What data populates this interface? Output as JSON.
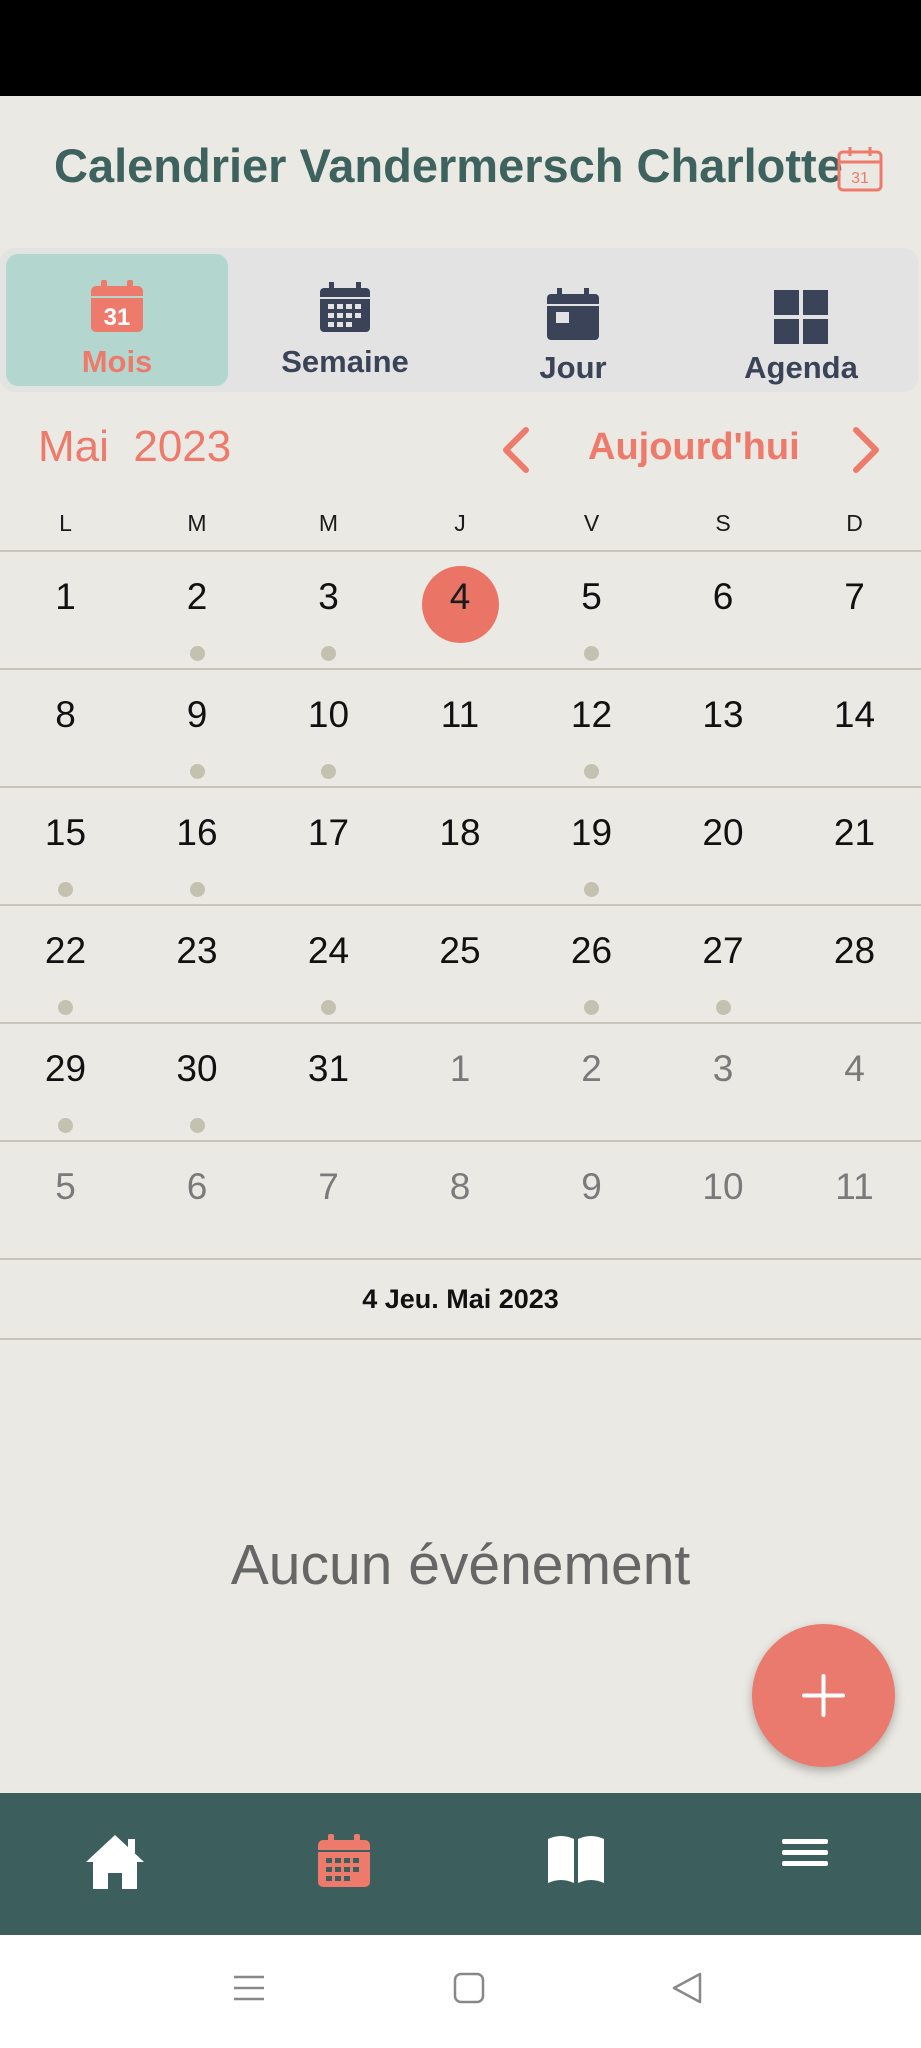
{
  "header": {
    "title": "Calendrier Vandermersch Charlotte",
    "calendar_icon": "calendar-icon"
  },
  "view_tabs": [
    {
      "label": "Mois",
      "icon": "calendar-month-icon",
      "active": true,
      "badge": "31"
    },
    {
      "label": "Semaine",
      "icon": "calendar-week-icon",
      "active": false
    },
    {
      "label": "Jour",
      "icon": "calendar-day-icon",
      "active": false
    },
    {
      "label": "Agenda",
      "icon": "grid-icon",
      "active": false
    }
  ],
  "month_nav": {
    "month": "Mai",
    "year": "2023",
    "today_label": "Aujourd'hui",
    "prev_icon": "chevron-left-icon",
    "next_icon": "chevron-right-icon"
  },
  "weekdays": [
    "L",
    "M",
    "M",
    "J",
    "V",
    "S",
    "D"
  ],
  "weeks": [
    [
      {
        "d": "1",
        "cur": true,
        "dot": false
      },
      {
        "d": "2",
        "cur": true,
        "dot": true
      },
      {
        "d": "3",
        "cur": true,
        "dot": true
      },
      {
        "d": "4",
        "cur": true,
        "dot": false,
        "today": true
      },
      {
        "d": "5",
        "cur": true,
        "dot": true
      },
      {
        "d": "6",
        "cur": true,
        "dot": false
      },
      {
        "d": "7",
        "cur": true,
        "dot": false
      }
    ],
    [
      {
        "d": "8",
        "cur": true,
        "dot": false
      },
      {
        "d": "9",
        "cur": true,
        "dot": true
      },
      {
        "d": "10",
        "cur": true,
        "dot": true
      },
      {
        "d": "11",
        "cur": true,
        "dot": false
      },
      {
        "d": "12",
        "cur": true,
        "dot": true
      },
      {
        "d": "13",
        "cur": true,
        "dot": false
      },
      {
        "d": "14",
        "cur": true,
        "dot": false
      }
    ],
    [
      {
        "d": "15",
        "cur": true,
        "dot": true
      },
      {
        "d": "16",
        "cur": true,
        "dot": true
      },
      {
        "d": "17",
        "cur": true,
        "dot": false
      },
      {
        "d": "18",
        "cur": true,
        "dot": false
      },
      {
        "d": "19",
        "cur": true,
        "dot": true
      },
      {
        "d": "20",
        "cur": true,
        "dot": false
      },
      {
        "d": "21",
        "cur": true,
        "dot": false
      }
    ],
    [
      {
        "d": "22",
        "cur": true,
        "dot": true
      },
      {
        "d": "23",
        "cur": true,
        "dot": false
      },
      {
        "d": "24",
        "cur": true,
        "dot": true
      },
      {
        "d": "25",
        "cur": true,
        "dot": false
      },
      {
        "d": "26",
        "cur": true,
        "dot": true
      },
      {
        "d": "27",
        "cur": true,
        "dot": true
      },
      {
        "d": "28",
        "cur": true,
        "dot": false
      }
    ],
    [
      {
        "d": "29",
        "cur": true,
        "dot": true
      },
      {
        "d": "30",
        "cur": true,
        "dot": true
      },
      {
        "d": "31",
        "cur": true,
        "dot": false
      },
      {
        "d": "1",
        "cur": false,
        "dot": false
      },
      {
        "d": "2",
        "cur": false,
        "dot": false
      },
      {
        "d": "3",
        "cur": false,
        "dot": false
      },
      {
        "d": "4",
        "cur": false,
        "dot": false
      }
    ],
    [
      {
        "d": "5",
        "cur": false,
        "dot": false
      },
      {
        "d": "6",
        "cur": false,
        "dot": false
      },
      {
        "d": "7",
        "cur": false,
        "dot": false
      },
      {
        "d": "8",
        "cur": false,
        "dot": false
      },
      {
        "d": "9",
        "cur": false,
        "dot": false
      },
      {
        "d": "10",
        "cur": false,
        "dot": false
      },
      {
        "d": "11",
        "cur": false,
        "dot": false
      }
    ]
  ],
  "selected_date": "4 Jeu. Mai 2023",
  "empty_state": "Aucun événement",
  "fab_icon": "plus-icon",
  "bottom_nav": [
    {
      "name": "home-icon"
    },
    {
      "name": "calendar-icon",
      "active": true
    },
    {
      "name": "book-icon"
    },
    {
      "name": "menu-icon"
    }
  ],
  "system_nav": [
    "recent-apps-icon",
    "home-square-icon",
    "back-icon"
  ],
  "colors": {
    "accent": "#ee7a6c",
    "teal": "#3c5e5d",
    "active_tab": "#b3d7cf",
    "background": "#ebe9e3",
    "event_dot": "#c3c1b0"
  }
}
